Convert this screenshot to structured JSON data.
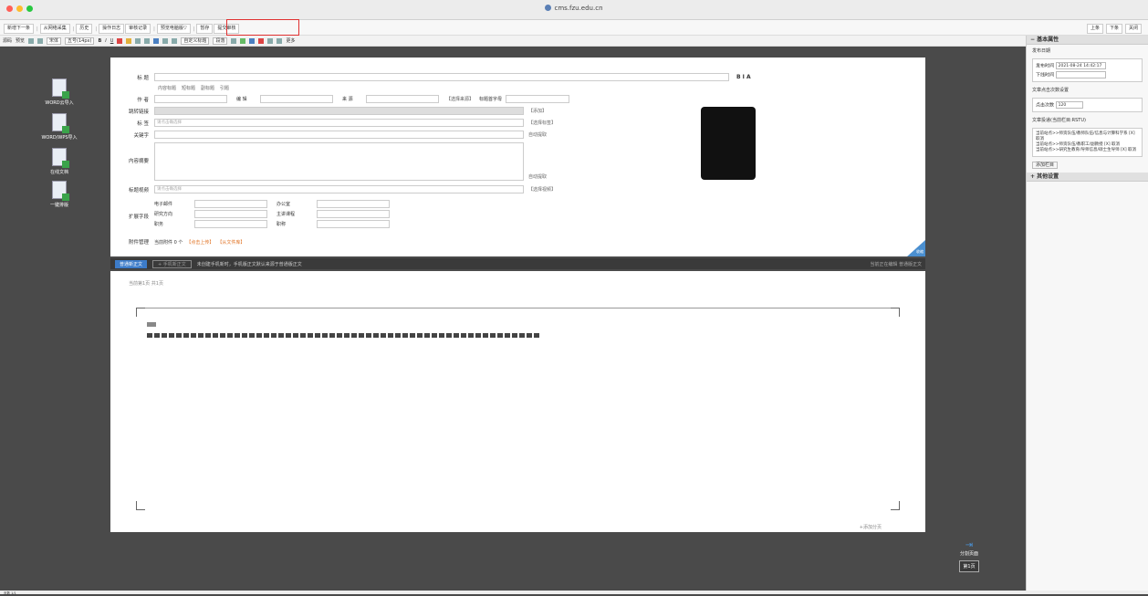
{
  "window": {
    "url": "cms.fzu.edu.cn"
  },
  "toolbar1": {
    "buttons": [
      "新增下一条",
      "从网络采集",
      "历史",
      "操作日志",
      "审核记录",
      "预览电脑版▽",
      "暂存",
      "提交审核"
    ],
    "right_buttons": [
      "上条",
      "下条",
      "关闭"
    ]
  },
  "toolbar2": {
    "source": "源码",
    "preview": "预览",
    "font": "宋体",
    "size": "五号(14px)",
    "style": "自定义标题",
    "para": "段落",
    "more": "更多"
  },
  "left_tools": [
    "WORD云导入",
    "WORD/WPS导入",
    "在线文档",
    "一键排版"
  ],
  "form": {
    "title_label": "标 题",
    "title_value": "",
    "checks": [
      "内容标题",
      "短标题",
      "副标题",
      "引题"
    ],
    "author_label": "作 者",
    "editor_label": "编 辑",
    "source_label": "来 源",
    "source_select": "【选择来源】",
    "pinyin_label": "标题首字母",
    "link_label": "跳转链接",
    "add_label": "【添加】",
    "tag_label": "标 签",
    "tag_placeholder": "请点击确选择",
    "tag_select": "【选择标签】",
    "keyword_label": "关键字",
    "auto_extract": "自动提取",
    "summary_label": "内容摘要",
    "auto_extract2": "自动提取",
    "video_label": "标题视频",
    "video_placeholder": "请点击确选择",
    "video_select": "【选择视频】",
    "ext_label": "扩展字段",
    "ext_fields": [
      "电子邮件",
      "研究方向",
      "职务"
    ],
    "ext_fields2": [
      "办公室",
      "主讲课程",
      "职称"
    ],
    "attach_label": "附件管理",
    "attach_text": "当前附件 0 个",
    "upload": "【点击上传】",
    "file_lib": "【从文件库】",
    "collapse": "收缩"
  },
  "editbar": {
    "btn1": "普通新正文",
    "btn2": "+ 手机新正文",
    "note": "未创建手机新时，手机版正文默认来源于普通版正文",
    "right": "当前正在编辑 普通版正文"
  },
  "doc": {
    "page_info": "当前第1页 共1页",
    "add_page": "+添加分页"
  },
  "rightpanel": {
    "basic": "基本属性",
    "publish_date": "发布日期",
    "pub_time_label": "发布时间",
    "pub_time": "2021-08-24 14:42:17",
    "off_time_label": "下线时间",
    "clicks_title": "文章点击次数设置",
    "clicks_label": "点击次数",
    "clicks": "120",
    "col_title": "文章投递(当前栏目:RSTU)",
    "cols": [
      "当前站点>>师资队伍/教师队伍/信息与计算科学系 [X] 取消",
      "当前站点>>师资队伍/教职工/副教授 [X] 取消",
      "当前站点>>研究生教育/导师信息/硕士生导师 [X] 取消"
    ],
    "add_col": "添加栏目",
    "other": "其他设置"
  },
  "pagebox": {
    "label": "分割页面",
    "page": "第1页"
  },
  "status": {
    "left": "页数 1/1"
  }
}
